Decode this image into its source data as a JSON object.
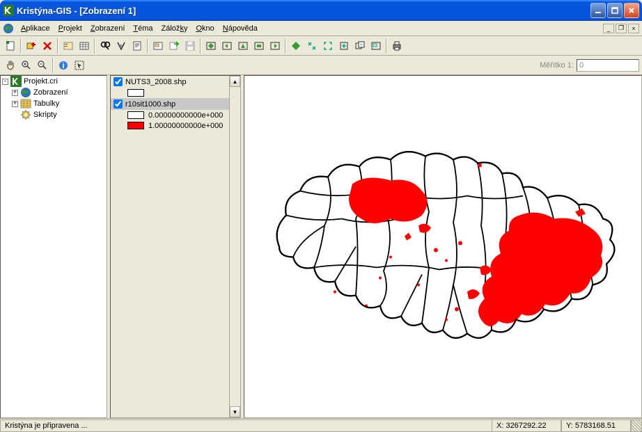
{
  "window": {
    "title": "Kristýna-GIS - [Zobrazení 1]"
  },
  "menu": {
    "app": "Aplikace",
    "project": "Projekt",
    "view": "Zobrazení",
    "theme": "Téma",
    "bookmarks": "Záložky",
    "window": "Okno",
    "help": "Nápověda"
  },
  "scale": {
    "label": "Měřítko 1:",
    "value": "0"
  },
  "tree": {
    "root": "Projekt.cri",
    "nodes": {
      "views": "Zobrazení",
      "tables": "Tabulky",
      "scripts": "Skripty"
    }
  },
  "toc": {
    "layer1": {
      "name": "NUTS3_2008.shp",
      "checked": true
    },
    "layer2": {
      "name": "r10sit1000.shp",
      "checked": true,
      "class0": "0.00000000000e+000",
      "class1": "1.00000000000e+000"
    }
  },
  "status": {
    "ready": "Kristýna je připravena ...",
    "x": "X: 3267292.22",
    "y": "Y: 5783168.51"
  }
}
